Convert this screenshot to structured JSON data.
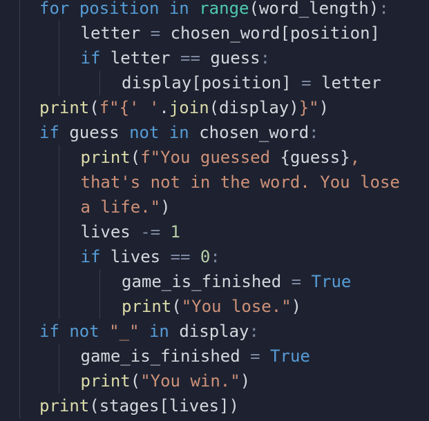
{
  "editor": {
    "background": "#1e2230",
    "colors": {
      "keyword": "#569cd6",
      "function": "#dcdcaa",
      "builtin": "#4ec9b0",
      "string": "#ce9178",
      "number": "#b5cea8",
      "operator": "#7f8aa3",
      "identifier": "#d4d7dd",
      "guide": "#3a3f4d"
    },
    "lines": [
      {
        "indent": 1,
        "tokens": [
          {
            "t": "for",
            "c": "kw"
          },
          {
            "t": " ",
            "c": "pn"
          },
          {
            "t": "position",
            "c": "kw"
          },
          {
            "t": " ",
            "c": "pn"
          },
          {
            "t": "in",
            "c": "kw"
          },
          {
            "t": " ",
            "c": "pn"
          },
          {
            "t": "range",
            "c": "bi"
          },
          {
            "t": "(word_length)",
            "c": "id"
          },
          {
            "t": ":",
            "c": "op"
          }
        ]
      },
      {
        "indent": 2,
        "tokens": [
          {
            "t": "letter",
            "c": "id"
          },
          {
            "t": " = ",
            "c": "op"
          },
          {
            "t": "chosen_word[position]",
            "c": "id"
          }
        ]
      },
      {
        "indent": 2,
        "tokens": [
          {
            "t": "if",
            "c": "kw"
          },
          {
            "t": " letter ",
            "c": "id"
          },
          {
            "t": "==",
            "c": "op"
          },
          {
            "t": " guess",
            "c": "id"
          },
          {
            "t": ":",
            "c": "op"
          }
        ]
      },
      {
        "indent": 3,
        "tokens": [
          {
            "t": "display[position]",
            "c": "id"
          },
          {
            "t": " = ",
            "c": "op"
          },
          {
            "t": "letter",
            "c": "id"
          }
        ]
      },
      {
        "indent": 1,
        "tokens": [
          {
            "t": "print",
            "c": "fn"
          },
          {
            "t": "(",
            "c": "pn"
          },
          {
            "t": "f\"{' '",
            "c": "str"
          },
          {
            "t": ".",
            "c": "pn"
          },
          {
            "t": "join",
            "c": "fn"
          },
          {
            "t": "(display)",
            "c": "id"
          },
          {
            "t": "}\"",
            "c": "str"
          },
          {
            "t": ")",
            "c": "pn"
          }
        ]
      },
      {
        "indent": 1,
        "tokens": [
          {
            "t": "if",
            "c": "kw"
          },
          {
            "t": " guess ",
            "c": "id"
          },
          {
            "t": "not in",
            "c": "kw"
          },
          {
            "t": " chosen_word",
            "c": "id"
          },
          {
            "t": ":",
            "c": "op"
          }
        ]
      },
      {
        "indent": 2,
        "tokens": [
          {
            "t": "print",
            "c": "fn"
          },
          {
            "t": "(",
            "c": "pn"
          },
          {
            "t": "f\"You guessed ",
            "c": "str"
          },
          {
            "t": "{guess}",
            "c": "id"
          },
          {
            "t": ",",
            "c": "str"
          }
        ]
      },
      {
        "indent": 2,
        "tokens": [
          {
            "t": "that's not in the word. You lose",
            "c": "str"
          }
        ]
      },
      {
        "indent": 2,
        "tokens": [
          {
            "t": "a life.\"",
            "c": "str"
          },
          {
            "t": ")",
            "c": "pn"
          }
        ]
      },
      {
        "indent": 2,
        "tokens": [
          {
            "t": "lives",
            "c": "id"
          },
          {
            "t": " -= ",
            "c": "op"
          },
          {
            "t": "1",
            "c": "num"
          }
        ]
      },
      {
        "indent": 2,
        "tokens": [
          {
            "t": "if",
            "c": "kw"
          },
          {
            "t": " lives ",
            "c": "id"
          },
          {
            "t": "==",
            "c": "op"
          },
          {
            "t": " ",
            "c": "pn"
          },
          {
            "t": "0",
            "c": "num"
          },
          {
            "t": ":",
            "c": "op"
          }
        ]
      },
      {
        "indent": 3,
        "tokens": [
          {
            "t": "game_is_finished",
            "c": "id"
          },
          {
            "t": " = ",
            "c": "op"
          },
          {
            "t": "True",
            "c": "kw"
          }
        ]
      },
      {
        "indent": 3,
        "tokens": [
          {
            "t": "print",
            "c": "fn"
          },
          {
            "t": "(",
            "c": "pn"
          },
          {
            "t": "\"You lose.\"",
            "c": "str"
          },
          {
            "t": ")",
            "c": "pn"
          }
        ]
      },
      {
        "indent": 1,
        "tokens": [
          {
            "t": "if",
            "c": "kw"
          },
          {
            "t": " ",
            "c": "pn"
          },
          {
            "t": "not",
            "c": "kw"
          },
          {
            "t": " ",
            "c": "pn"
          },
          {
            "t": "\"_\"",
            "c": "str"
          },
          {
            "t": " ",
            "c": "pn"
          },
          {
            "t": "in",
            "c": "kw"
          },
          {
            "t": " display",
            "c": "id"
          },
          {
            "t": ":",
            "c": "op"
          }
        ]
      },
      {
        "indent": 2,
        "tokens": [
          {
            "t": "game_is_finished",
            "c": "id"
          },
          {
            "t": " = ",
            "c": "op"
          },
          {
            "t": "True",
            "c": "kw"
          }
        ]
      },
      {
        "indent": 2,
        "tokens": [
          {
            "t": "print",
            "c": "fn"
          },
          {
            "t": "(",
            "c": "pn"
          },
          {
            "t": "\"You win.\"",
            "c": "str"
          },
          {
            "t": ")",
            "c": "pn"
          }
        ]
      },
      {
        "indent": 1,
        "tokens": [
          {
            "t": "print",
            "c": "fn"
          },
          {
            "t": "(stages[lives])",
            "c": "id"
          }
        ]
      }
    ]
  }
}
